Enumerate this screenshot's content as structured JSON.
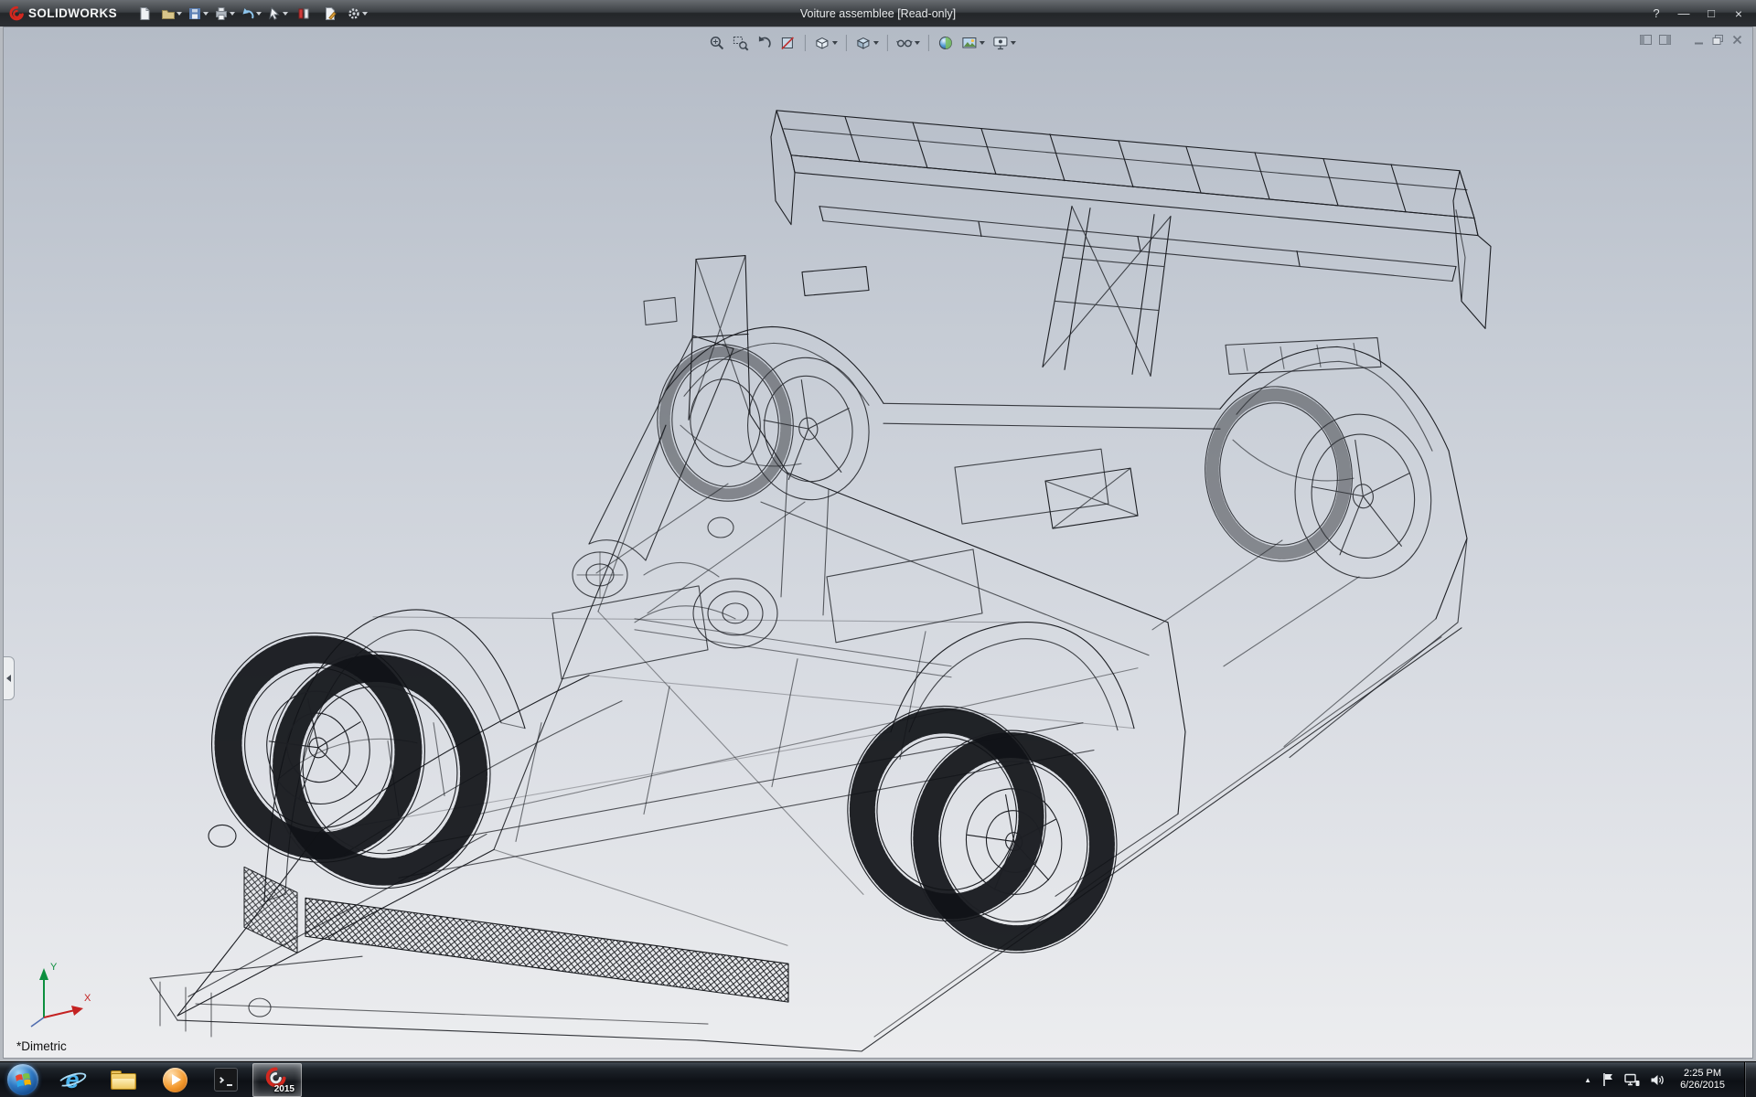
{
  "app": {
    "name": "SOLIDWORKS",
    "document_title": "Voiture assemblee [Read-only]"
  },
  "titlebar": {
    "quick_tools": [
      "new",
      "open",
      "save",
      "print",
      "undo",
      "select",
      "measure",
      "file-properties",
      "options"
    ],
    "help_glyph": "?",
    "minimize_glyph": "—",
    "restore_glyph": "□",
    "close_glyph": "×"
  },
  "headsup_toolbar": {
    "tools": [
      "zoom-to-fit",
      "zoom-to-area",
      "previous-view",
      "section-view",
      "view-orientation",
      "display-style",
      "hide-show-items",
      "edit-appearance",
      "apply-scene",
      "view-settings"
    ]
  },
  "document_window": {
    "controls": [
      "dock-left",
      "dock-right",
      "minimize",
      "restore",
      "close"
    ]
  },
  "viewport": {
    "orientation_label": "*Dimetric",
    "triad": {
      "x_label": "X",
      "y_label": "Y"
    }
  },
  "taskbar": {
    "items": [
      "start",
      "internet-explorer",
      "windows-explorer",
      "media-player",
      "command-prompt",
      "solidworks"
    ],
    "ie_glyph": "e",
    "tray_expand_glyph": "▲",
    "solidworks_badge": "2015",
    "clock": {
      "time": "2:25 PM",
      "date": "6/26/2015"
    }
  },
  "colors": {
    "titlebar": "#3c4044",
    "viewport_top": "#b4bbc6",
    "viewport_bottom": "#ecedef",
    "wireframe": "#1d1f24",
    "logo_red": "#d5281f",
    "taskbar_bg": "#0d1015"
  }
}
